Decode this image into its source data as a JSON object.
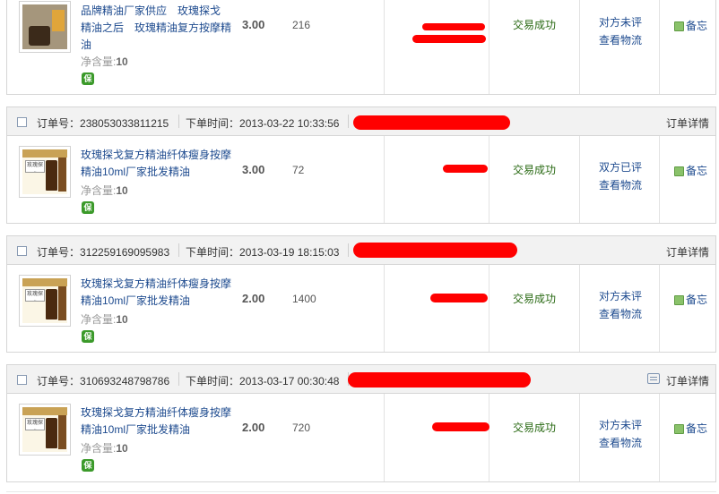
{
  "labels": {
    "order_no": "订单号：",
    "order_time": "下单时间：",
    "order_detail": "订单详情",
    "net_weight": "净含量:",
    "guarantee": "保",
    "remark": "备忘",
    "logistics": "查看物流"
  },
  "orders": [
    {
      "title": "品牌精油厂家供应　玫瑰探戈　精油之后　玫瑰精油复方按摩精油",
      "net": "10",
      "price": "3.00",
      "qty": "216",
      "status": "交易成功",
      "eval": "对方未评"
    },
    {
      "order_no": "238053033811215",
      "time": "2013-03-22 10:33:56",
      "title": "玫瑰探戈复方精油纤体瘦身按摩精油10ml厂家批发精油",
      "net": "10",
      "price": "3.00",
      "qty": "72",
      "status": "交易成功",
      "eval": "双方已评",
      "thumb_tag": "玫瑰探戈 10ML"
    },
    {
      "order_no": "312259169095983",
      "time": "2013-03-19 18:15:03",
      "title": "玫瑰探戈复方精油纤体瘦身按摩精油10ml厂家批发精油",
      "net": "10",
      "price": "2.00",
      "qty": "1400",
      "status": "交易成功",
      "eval": "对方未评",
      "thumb_tag": "玫瑰探戈 10ML"
    },
    {
      "order_no": "310693248798786",
      "time": "2013-03-17 00:30:48",
      "title": "玫瑰探戈复方精油纤体瘦身按摩精油10ml厂家批发精油",
      "net": "10",
      "price": "2.00",
      "qty": "720",
      "status": "交易成功",
      "eval": "对方未评",
      "thumb_tag": "玫瑰探戈 10ML"
    }
  ],
  "colors": {
    "link": "#1e4b8f",
    "success": "#2a6a14",
    "redaction": "#ff0000",
    "header_bg": "#f2f2f2"
  }
}
